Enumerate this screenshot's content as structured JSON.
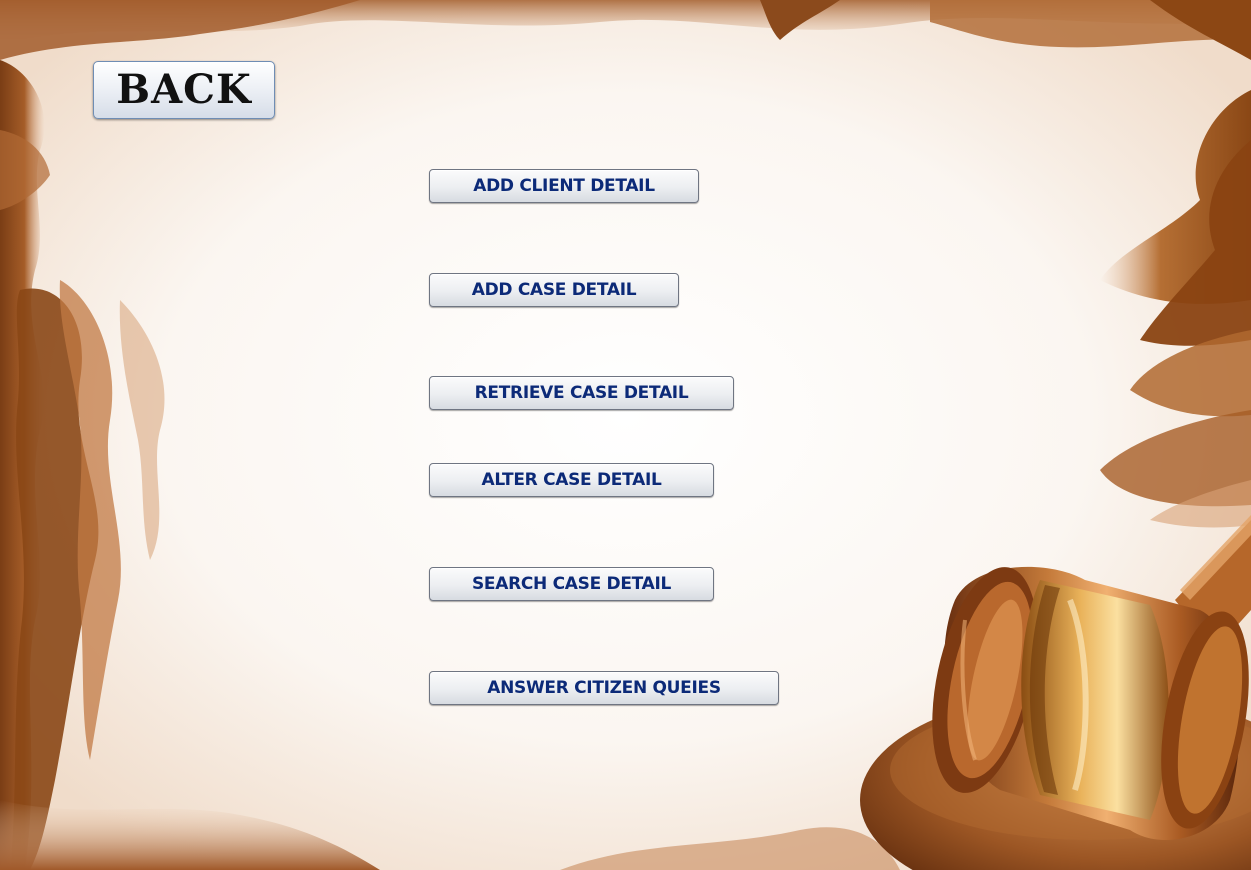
{
  "back_label": "BACK",
  "menu": {
    "add_client": "ADD CLIENT DETAIL",
    "add_case": "ADD CASE DETAIL",
    "retrieve_case": "RETRIEVE CASE DETAIL",
    "alter_case": "ALTER CASE DETAIL",
    "search_case": "SEARCH CASE DETAIL",
    "answer_queries": "ANSWER CITIZEN QUEIES"
  },
  "colors": {
    "brush_dark": "#8a4a1c",
    "brush_mid": "#b7733d",
    "brush_light": "#d9a37a",
    "button_text": "#0c2a78",
    "gavel_gold": "#c8843b"
  },
  "icons": {
    "background": "brush-stroke-border",
    "decoration": "gavel-icon"
  }
}
